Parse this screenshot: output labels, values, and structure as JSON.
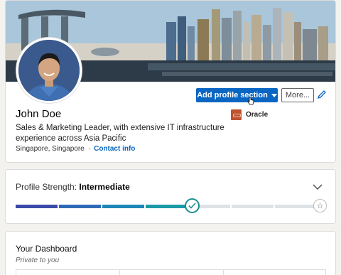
{
  "profile": {
    "name": "John Doe",
    "headline": "Sales & Marketing Leader, with extensive IT infrastructure experience across Asia Pacific",
    "location": "Singapore, Singapore",
    "separator": "·",
    "contact_label": "Contact info"
  },
  "actions": {
    "add_section_label": "Add profile section",
    "more_label": "More...",
    "edit_icon": "pencil-icon"
  },
  "company": {
    "name": "Oracle",
    "logo_color": "#c0522f"
  },
  "strength": {
    "label": "Profile Strength:",
    "level": "Intermediate",
    "progress_fraction": 0.6,
    "segments_total": 7,
    "segments_filled": 4,
    "colors": [
      "#3b4aa8",
      "#2f6bb5",
      "#1f86b8",
      "#1b9aa8"
    ],
    "track_color": "#dde2e6",
    "expand_icon": "chevron-down-icon",
    "goal_icon": "star-icon"
  },
  "dashboard": {
    "title": "Your Dashboard",
    "subtitle": "Private to you"
  },
  "brand": {
    "accent": "#0a66c2"
  }
}
